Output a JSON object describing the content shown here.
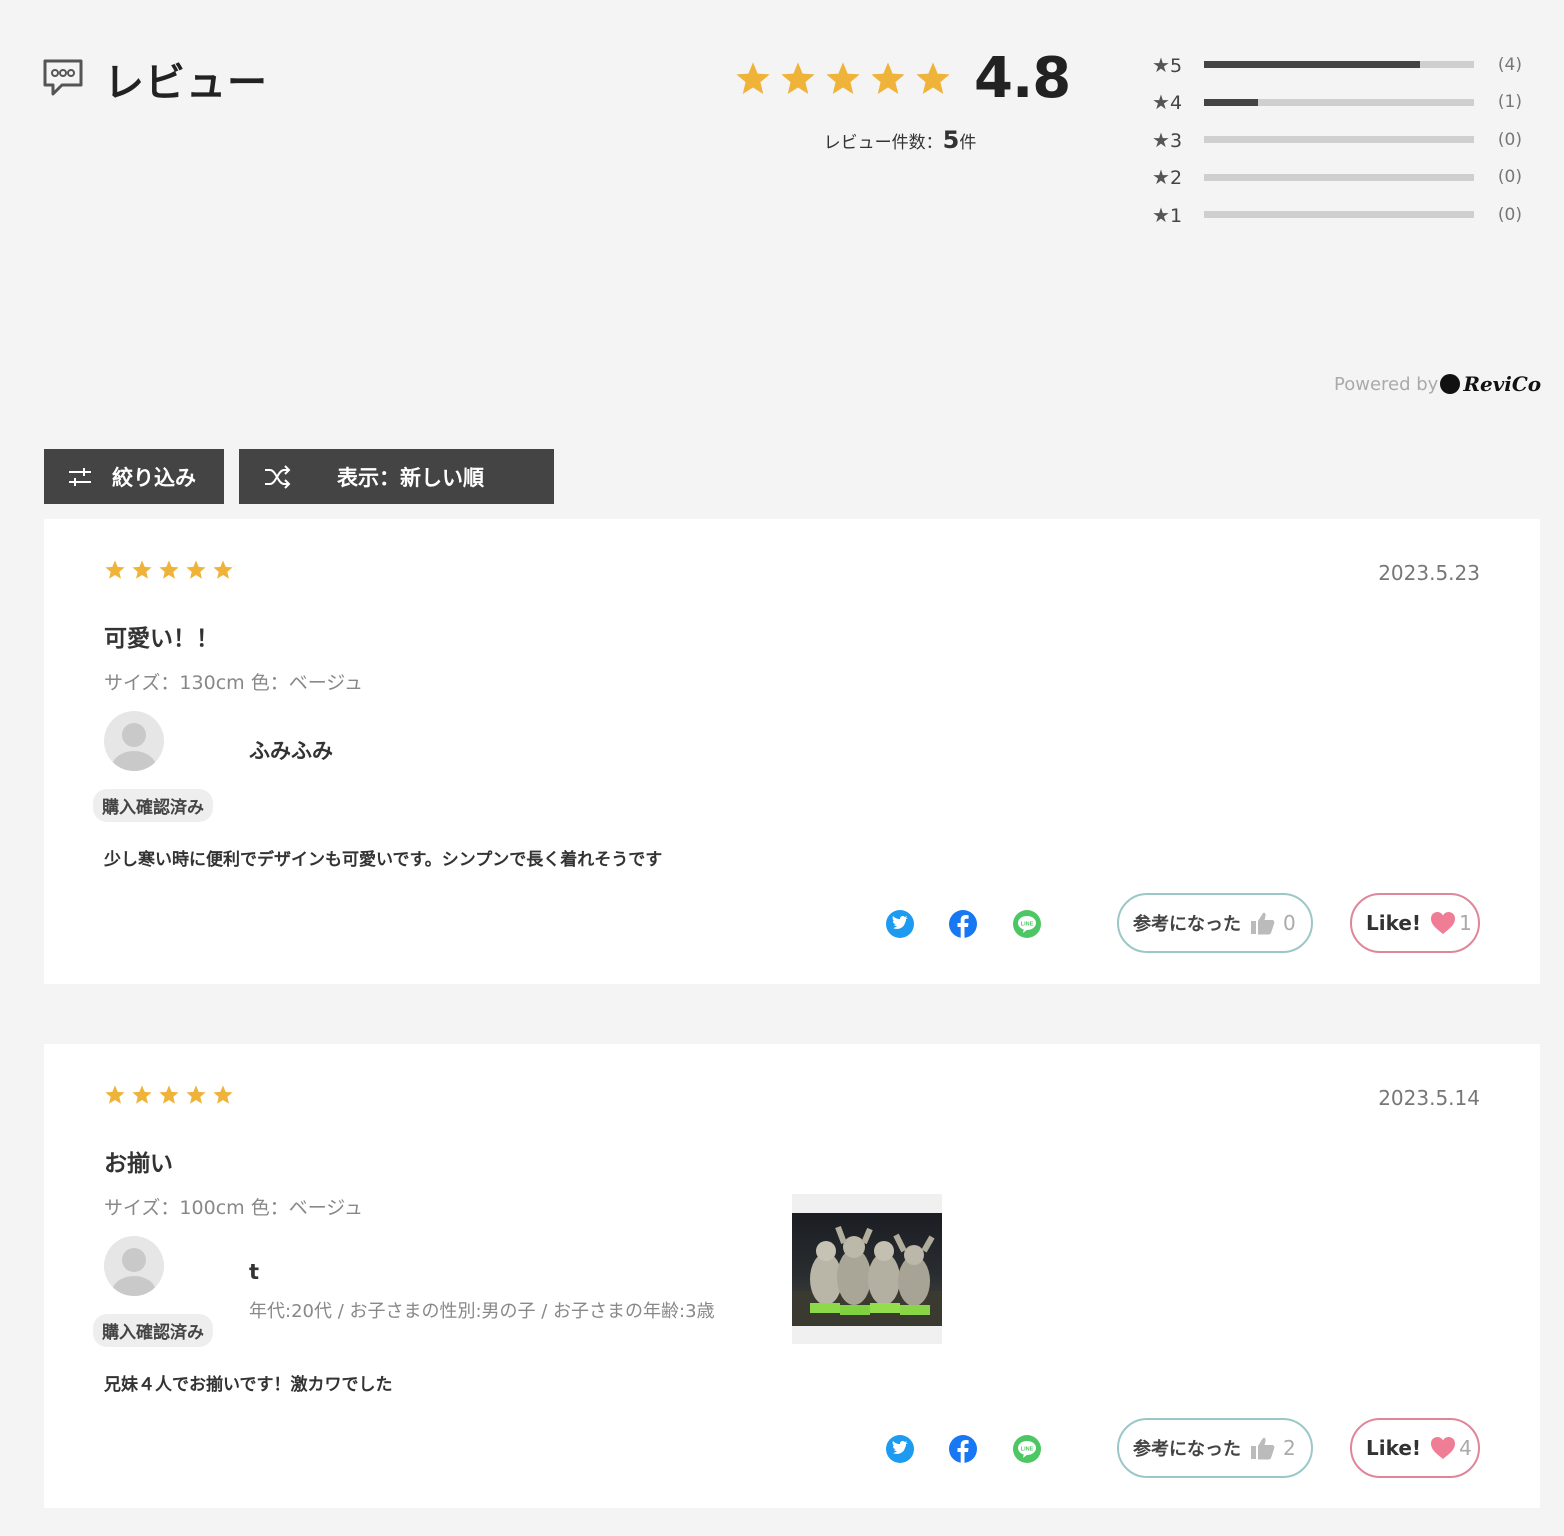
{
  "header": {
    "title": "レビュー",
    "icon": "chat-bubble-icon",
    "average": "4.8",
    "average_stars": 5,
    "count_label": "レビュー件数：",
    "count_num": "5",
    "count_unit": "件"
  },
  "distribution": [
    {
      "star": "5",
      "count": "(4)",
      "fraction": 0.8
    },
    {
      "star": "4",
      "count": "(1)",
      "fraction": 0.2
    },
    {
      "star": "3",
      "count": "(0)",
      "fraction": 0
    },
    {
      "star": "2",
      "count": "(0)",
      "fraction": 0
    },
    {
      "star": "1",
      "count": "(0)",
      "fraction": 0
    }
  ],
  "powered": {
    "text": "Powered by",
    "logo": "ReviCo"
  },
  "toolbar": {
    "filter_label": "絞り込み",
    "sort_label": "表示：新しい順"
  },
  "colors": {
    "star": "#f0b33a",
    "button_bg": "#444444",
    "helpful_border": "#9cc7c9",
    "like_border": "#e0859a",
    "heart": "#ef7d95"
  },
  "reviews": [
    {
      "stars": 5,
      "date": "2023.5.23",
      "title": "可愛い！！",
      "attributes": "サイズ：130cm 色：ベージュ",
      "name": "ふみふみ",
      "meta": "",
      "verified": "購入確認済み",
      "body": "少し寒い時に便利でデザインも可愛いです。シンプンで長く着れそうです",
      "helpful_label": "参考になった",
      "helpful_count": "0",
      "like_label": "Like!",
      "like_count": "1"
    },
    {
      "stars": 5,
      "date": "2023.5.14",
      "title": "お揃い",
      "attributes": "サイズ：100cm 色：ベージュ",
      "name": "t",
      "meta": "年代:20代 / お子さまの性別:男の子 / お子さまの年齢:3歳",
      "verified": "購入確認済み",
      "body": "兄妹４人でお揃いです！激カワでした",
      "helpful_label": "参考になった",
      "helpful_count": "2",
      "like_label": "Like!",
      "like_count": "4",
      "photo": "review-photo"
    }
  ]
}
